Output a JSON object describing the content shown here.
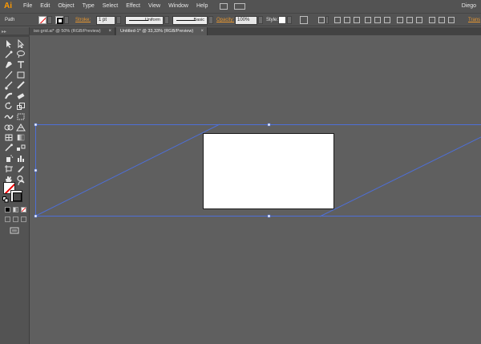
{
  "app": {
    "logo": "Ai",
    "user": "Diego"
  },
  "menu": [
    "File",
    "Edit",
    "Object",
    "Type",
    "Select",
    "Effect",
    "View",
    "Window",
    "Help"
  ],
  "control_bar": {
    "selection_label": "Path",
    "stroke_label": "Stroke:",
    "stroke_weight": "1 pt",
    "profile": "Uniform",
    "brush": "Basic",
    "opacity_label": "Opacity:",
    "opacity_value": "100%",
    "style_label": "Style:",
    "transform_label": "Trans"
  },
  "tabs": [
    {
      "label": "iso grid.ai* @ 50% (RGB/Preview)",
      "active": false,
      "close": "×"
    },
    {
      "label": "Untitled-1* @ 33,33% (RGB/Preview)",
      "active": true,
      "close": "×"
    }
  ],
  "colors": {
    "accent_orange": "#ff9a00",
    "selection_blue": "#4e6fd6",
    "canvas": "#5f5f5f",
    "panel": "#535353"
  },
  "tools": [
    "selection-tool-icon",
    "direct-selection-tool-icon",
    "magic-wand-icon",
    "lasso-icon",
    "pen-tool-icon",
    "type-tool-icon",
    "line-segment-icon",
    "rectangle-tool-icon",
    "paintbrush-icon",
    "pencil-icon",
    "blob-brush-icon",
    "eraser-icon",
    "rotate-icon",
    "scale-icon",
    "warp-icon",
    "free-transform-icon",
    "shape-builder-icon",
    "perspective-grid-icon",
    "mesh-icon",
    "gradient-icon",
    "eyedropper-icon",
    "blend-icon",
    "symbol-sprayer-icon",
    "column-graph-icon",
    "artboard-tool-icon",
    "slice-icon",
    "hand-tool-icon",
    "zoom-tool-icon"
  ]
}
